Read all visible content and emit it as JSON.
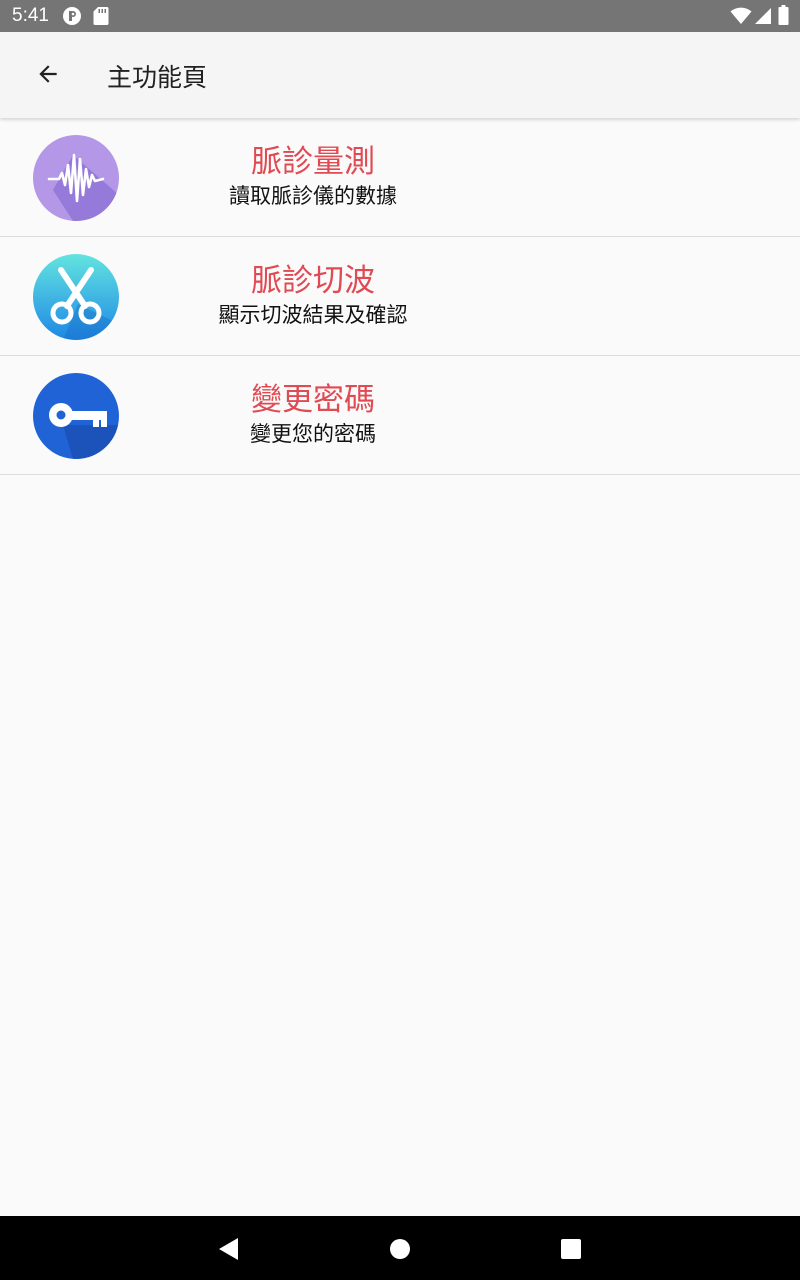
{
  "status_bar": {
    "time": "5:41",
    "icons": [
      "notification-app-icon",
      "sd-card-icon",
      "wifi-icon",
      "signal-icon",
      "battery-icon"
    ]
  },
  "app_bar": {
    "back_icon": "arrow-back-icon",
    "title": "主功能頁"
  },
  "menu": {
    "items": [
      {
        "icon": "pulse-waveform-icon",
        "title": "脈診量測",
        "subtitle": "讀取脈診儀的數據",
        "icon_colors": [
          "#b497e6",
          "#8f74d6"
        ]
      },
      {
        "icon": "scissors-icon",
        "title": "脈診切波",
        "subtitle": "顯示切波結果及確認",
        "icon_colors": [
          "#63e4e0",
          "#1e88e5"
        ]
      },
      {
        "icon": "key-icon",
        "title": "變更密碼",
        "subtitle": "變更您的密碼",
        "icon_colors": [
          "#1f63d6",
          "#1a4fb3"
        ]
      }
    ]
  },
  "nav_bar": {
    "icons": [
      "nav-back-icon",
      "nav-home-icon",
      "nav-recents-icon"
    ]
  },
  "colors": {
    "title_red": "#e04a53",
    "status_bar": "#757575",
    "app_bar": "#f5f5f5",
    "background": "#fafafa"
  }
}
